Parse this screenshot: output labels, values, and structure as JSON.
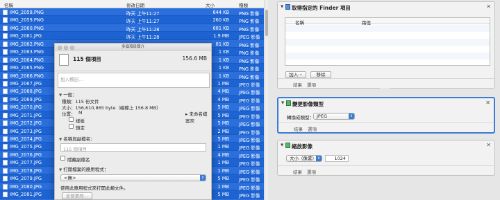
{
  "finder": {
    "headers": {
      "name": "名稱",
      "date": "修改日期",
      "size": "大小",
      "kind": "種類"
    },
    "rows": [
      {
        "name": "IMG_2058.PNG",
        "date": "昨天 上午11:27",
        "size": "644 KB",
        "kind": "PNG 影像"
      },
      {
        "name": "IMG_2059.PNG",
        "date": "昨天 上午11:27",
        "size": "260 KB",
        "kind": "PNG 影像"
      },
      {
        "name": "IMG_2060.PNG",
        "date": "昨天 上午11:28",
        "size": "681 KB",
        "kind": "PNG 影像"
      },
      {
        "name": "IMG_2061.JPG",
        "date": "昨天 上午11:28",
        "size": "1.9 MB",
        "kind": "JPEG 影像"
      },
      {
        "name": "IMG_2062.PNG",
        "date": "",
        "size": "81 KB",
        "kind": "PNG 影像"
      },
      {
        "name": "IMG_2063.PNG",
        "date": "",
        "size": "1 KB",
        "kind": "PNG 影像"
      },
      {
        "name": "IMG_2064.PNG",
        "date": "",
        "size": "1 KB",
        "kind": "PNG 影像"
      },
      {
        "name": "IMG_2065.PNG",
        "date": "",
        "size": "1 KB",
        "kind": "PNG 影像"
      },
      {
        "name": "IMG_2066.PNG",
        "date": "",
        "size": "1 KB",
        "kind": "PNG 影像"
      },
      {
        "name": "IMG_2067.JPG",
        "date": "",
        "size": "1 MB",
        "kind": "JPEG 影像"
      },
      {
        "name": "IMG_2068.JPG",
        "date": "",
        "size": "4 MB",
        "kind": "JPEG 影像"
      },
      {
        "name": "IMG_2069.JPG",
        "date": "",
        "size": "4 MB",
        "kind": "JPEG 影像"
      },
      {
        "name": "IMG_2070.JPG",
        "date": "",
        "size": "5 MB",
        "kind": "JPEG 影像"
      },
      {
        "name": "IMG_2071.JPG",
        "date": "",
        "size": "5 MB",
        "kind": "JPEG 影像"
      },
      {
        "name": "IMG_2072.JPG",
        "date": "",
        "size": "5 MB",
        "kind": "JPEG 影像"
      },
      {
        "name": "IMG_2073.JPG",
        "date": "",
        "size": "2 MB",
        "kind": "JPEG 影像"
      },
      {
        "name": "IMG_2074.JPG",
        "date": "",
        "size": "5 MB",
        "kind": "JPEG 影像"
      },
      {
        "name": "IMG_2075.JPG",
        "date": "",
        "size": "1 MB",
        "kind": "JPEG 影像"
      },
      {
        "name": "IMG_2076.JPG",
        "date": "",
        "size": "4 MB",
        "kind": "JPEG 影像"
      },
      {
        "name": "IMG_2077.JPG",
        "date": "",
        "size": "1 MB",
        "kind": "JPEG 影像"
      },
      {
        "name": "IMG_2078.JPG",
        "date": "",
        "size": "1 MB",
        "kind": "JPEG 影像"
      },
      {
        "name": "IMG_2079.JPG",
        "date": "",
        "size": "5 MB",
        "kind": "JPEG 影像"
      },
      {
        "name": "IMG_2080.JPG",
        "date": "",
        "size": "1 MB",
        "kind": "JPEG 影像"
      },
      {
        "name": "IMG_2081.JPG",
        "date": "",
        "size": "5 MB",
        "kind": "JPEG 影像"
      },
      {
        "name": "IMG_2082.JPG",
        "date": "",
        "size": "5 MB",
        "kind": "JPEG 影像"
      }
    ]
  },
  "info": {
    "window_title": "多個項目簡介",
    "count": "115 個項目",
    "total_size": "156.6 MB",
    "tags_placeholder": "加入標記…",
    "general_header": "一般：",
    "kind_line": "種類：115 份文件",
    "size_line": "大小：156,610,865 byte（磁碟上 156.8 MB）",
    "where_label": "位置：",
    "where_value": "M",
    "where_suffix": "▸ 未命名檔案夾",
    "stationery": "樣板",
    "locked": "鎖定",
    "name_ext_header": "名稱與副檔名：",
    "name_placeholder": "115 個項目",
    "hide_ext": "隱藏副檔名",
    "open_with_header": "打開檔案的應用程式：",
    "app_value": "<無>",
    "use_app_line": "使用此應用程式來打開此類文件。",
    "change_all": "全部更改…"
  },
  "automator": {
    "action1": {
      "title": "取得指定的 Finder 項目",
      "col_name": "名稱",
      "col_path": "路徑",
      "add_button": "加入⋯",
      "remove_button": "移除",
      "results": "結果",
      "options": "選項"
    },
    "action2": {
      "title": "變更影像類型",
      "label": "轉換成類型：",
      "value": "JPEG",
      "results": "結果",
      "options": "選項"
    },
    "action3": {
      "title": "縮放影像",
      "mode": "大小（像素）",
      "pixels": "1024",
      "results": "結果",
      "options": "選項"
    }
  }
}
